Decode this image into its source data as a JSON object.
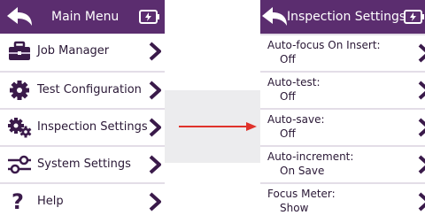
{
  "left_screen": {
    "header_title": "Main Menu",
    "items": [
      {
        "label": "Job Manager",
        "icon": "briefcase-icon"
      },
      {
        "label": "Test Configuration",
        "icon": "gear-icon"
      },
      {
        "label": "Inspection Settings",
        "icon": "gears-icon"
      },
      {
        "label": "System Settings",
        "icon": "sliders-icon"
      },
      {
        "label": "Help",
        "icon": "question-mark-icon"
      }
    ]
  },
  "right_screen": {
    "header_title": "Inspection Settings",
    "settings": [
      {
        "label": "Auto-focus On Insert:",
        "value": "Off"
      },
      {
        "label": "Auto-test:",
        "value": "Off"
      },
      {
        "label": "Auto-save:",
        "value": "Off"
      },
      {
        "label": "Auto-increment:",
        "value": "On Save"
      },
      {
        "label": "Focus Meter:",
        "value": "Show"
      }
    ]
  },
  "colors": {
    "header_bg": "#5b2d6f",
    "item_text": "#2a1836",
    "icon": "#3a1a4a",
    "arrow": "#e0322b",
    "band": "#ececee"
  }
}
